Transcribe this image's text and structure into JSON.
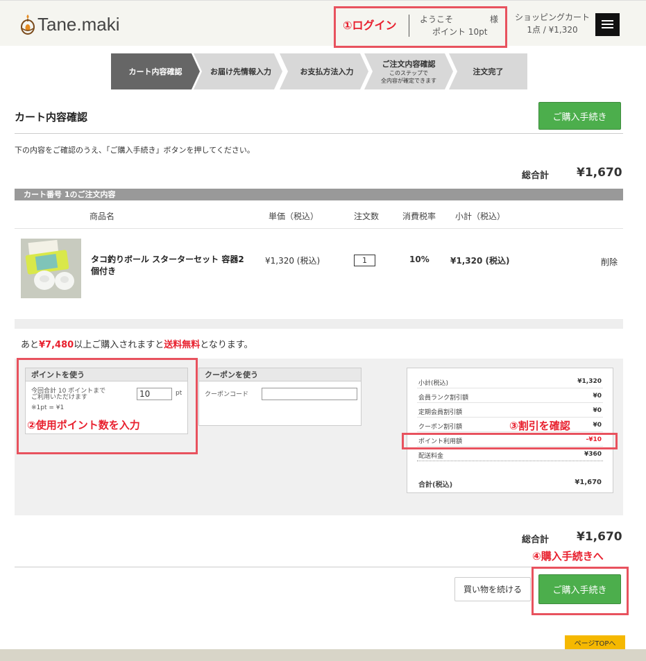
{
  "header": {
    "logo_text": "Tane.maki",
    "welcome": "ようこそ",
    "sama": "様",
    "points": "ポイント 10pt",
    "cart_title": "ショッピングカート",
    "cart_summary": "1点 / ¥1,320"
  },
  "steps": [
    {
      "label": "カート内容確認",
      "sub1": "",
      "sub2": ""
    },
    {
      "label": "お届け先情報入力",
      "sub1": "",
      "sub2": ""
    },
    {
      "label": "お支払方法入力",
      "sub1": "",
      "sub2": ""
    },
    {
      "label": "ご注文内容確認",
      "sub1": "このステップで",
      "sub2": "全内容が確定できます"
    },
    {
      "label": "注文完了",
      "sub1": "",
      "sub2": ""
    }
  ],
  "page": {
    "title": "カート内容確認",
    "purchase_button": "ご購入手続き",
    "instruction": "下の内容をご確認のうえ、「ご購入手続き」ボタンを押してください。",
    "total_label": "総合計",
    "total_value": "¥1,670"
  },
  "cart": {
    "bar_title": "カート番号 1のご注文内容",
    "headers": {
      "name": "商品名",
      "unit_price": "単価（税込）",
      "qty": "注文数",
      "tax_rate": "消費税率",
      "subtotal": "小計（税込）"
    },
    "item": {
      "name": "タコ釣りボール スターターセット 容器2個付き",
      "unit_price": "¥1,320 (税込)",
      "qty": "1",
      "tax_rate": "10%",
      "subtotal": "¥1,320 (税込)",
      "delete": "削除"
    }
  },
  "free_shipping": {
    "prefix": "あと",
    "amount": "¥7,480",
    "middle": "以上ご購入されますと",
    "highlight": "送料無料",
    "suffix": "となります。"
  },
  "points_panel": {
    "title": "ポイントを使う",
    "line1": "今回合計 10 ポイントまで",
    "line2": "ご利用いただけます",
    "rate": "※1pt = ¥1",
    "value": "10",
    "unit": "pt"
  },
  "coupon_panel": {
    "title": "クーポンを使う",
    "label": "クーポンコード",
    "value": ""
  },
  "summary": {
    "rows": [
      {
        "label": "小計(税込)",
        "value": "¥1,320"
      },
      {
        "label": "会員ランク割引額",
        "value": "¥0"
      },
      {
        "label": "定期会員割引額",
        "value": "¥0"
      },
      {
        "label": "クーポン割引額",
        "value": "¥0"
      },
      {
        "label": "ポイント利用額",
        "value": "-¥10"
      },
      {
        "label": "配送料金",
        "value": "¥360"
      }
    ],
    "total_label": "合計(税込)",
    "total_value": "¥1,670"
  },
  "annotations": {
    "a1": "①ログイン",
    "a2": "②使用ポイント数を入力",
    "a3": "③割引を確認",
    "a4": "④購入手続きへ"
  },
  "bottom": {
    "continue": "買い物を続ける",
    "purchase": "ご購入手続き",
    "page_top": "ページTOPへ"
  },
  "colors": {
    "accent_red": "#e8202e",
    "annotation_border": "#e8525e",
    "button_green": "#4cae4c",
    "page_top_yellow": "#f5b800"
  }
}
